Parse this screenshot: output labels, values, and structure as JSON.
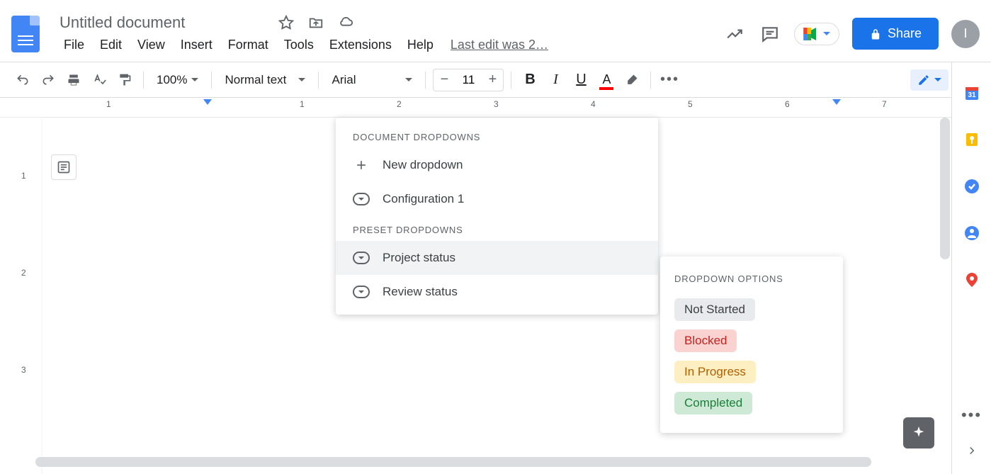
{
  "header": {
    "title": "Untitled document",
    "menus": [
      "File",
      "Edit",
      "View",
      "Insert",
      "Format",
      "Tools",
      "Extensions",
      "Help"
    ],
    "last_edit": "Last edit was 2…",
    "share_label": "Share",
    "avatar_letter": "I"
  },
  "toolbar": {
    "zoom": "100%",
    "style": "Normal text",
    "font": "Arial",
    "font_size": "11"
  },
  "ruler": {
    "h_numbers": [
      "1",
      "1",
      "2",
      "3",
      "4",
      "5",
      "6",
      "7"
    ],
    "v_numbers": [
      "1",
      "2",
      "3"
    ]
  },
  "popup": {
    "section1_title": "DOCUMENT DROPDOWNS",
    "new_dropdown_label": "New dropdown",
    "config_label": "Configuration 1",
    "section2_title": "PRESET DROPDOWNS",
    "project_status_label": "Project status",
    "review_status_label": "Review status"
  },
  "options_submenu": {
    "title": "DROPDOWN OPTIONS",
    "not_started": "Not Started",
    "blocked": "Blocked",
    "in_progress": "In Progress",
    "completed": "Completed"
  }
}
